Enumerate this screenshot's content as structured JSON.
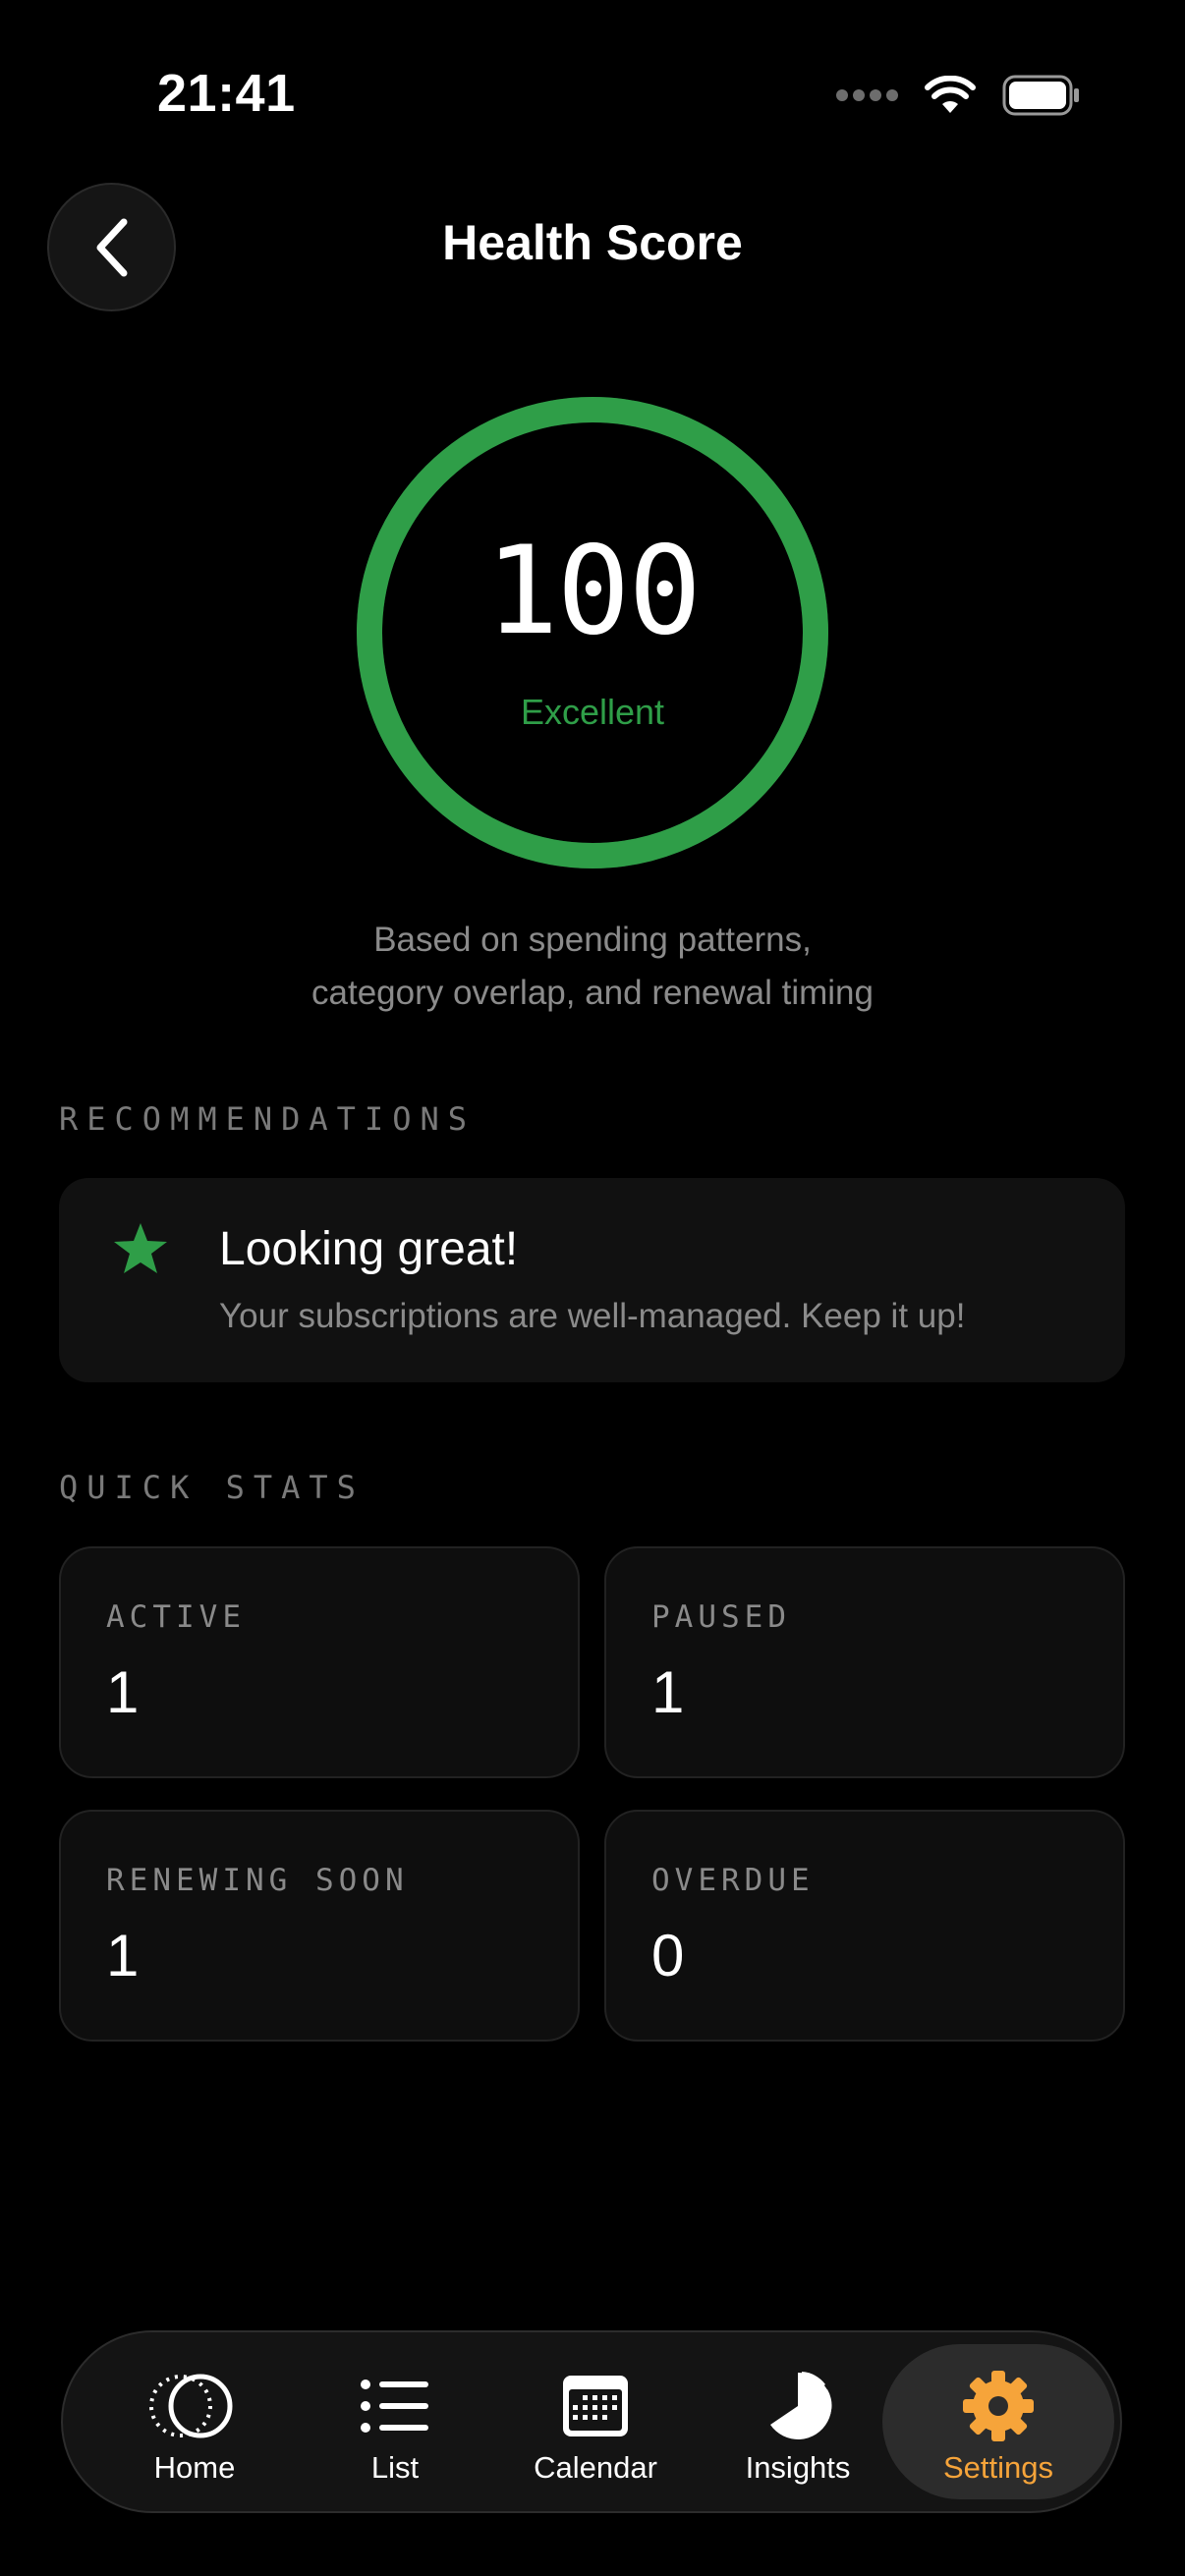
{
  "status_bar": {
    "time": "21:41"
  },
  "header": {
    "title": "Health Score"
  },
  "score": {
    "value": "100",
    "fraction": 1.0,
    "label": "Excellent",
    "description_line1": "Based on spending patterns,",
    "description_line2": "category overlap, and renewal timing"
  },
  "recommendations": {
    "heading": "RECOMMENDATIONS",
    "items": [
      {
        "icon": "star-icon",
        "title": "Looking great!",
        "body": "Your subscriptions are well-managed. Keep it up!"
      }
    ]
  },
  "quick_stats": {
    "heading": "QUICK STATS",
    "items": [
      {
        "label": "ACTIVE",
        "value": "1"
      },
      {
        "label": "PAUSED",
        "value": "1"
      },
      {
        "label": "RENEWING SOON",
        "value": "1"
      },
      {
        "label": "OVERDUE",
        "value": "0"
      }
    ]
  },
  "tab_bar": {
    "tabs": [
      {
        "label": "Home",
        "icon": "home-orbit-icon"
      },
      {
        "label": "List",
        "icon": "list-icon"
      },
      {
        "label": "Calendar",
        "icon": "calendar-icon"
      },
      {
        "label": "Insights",
        "icon": "pie-chart-icon"
      },
      {
        "label": "Settings",
        "icon": "gear-icon",
        "active": true
      }
    ]
  },
  "colors": {
    "background": "#000000",
    "score_green": "#2f9e48",
    "active_tab": "#f6a43a",
    "muted_text": "#8b8b8b"
  }
}
